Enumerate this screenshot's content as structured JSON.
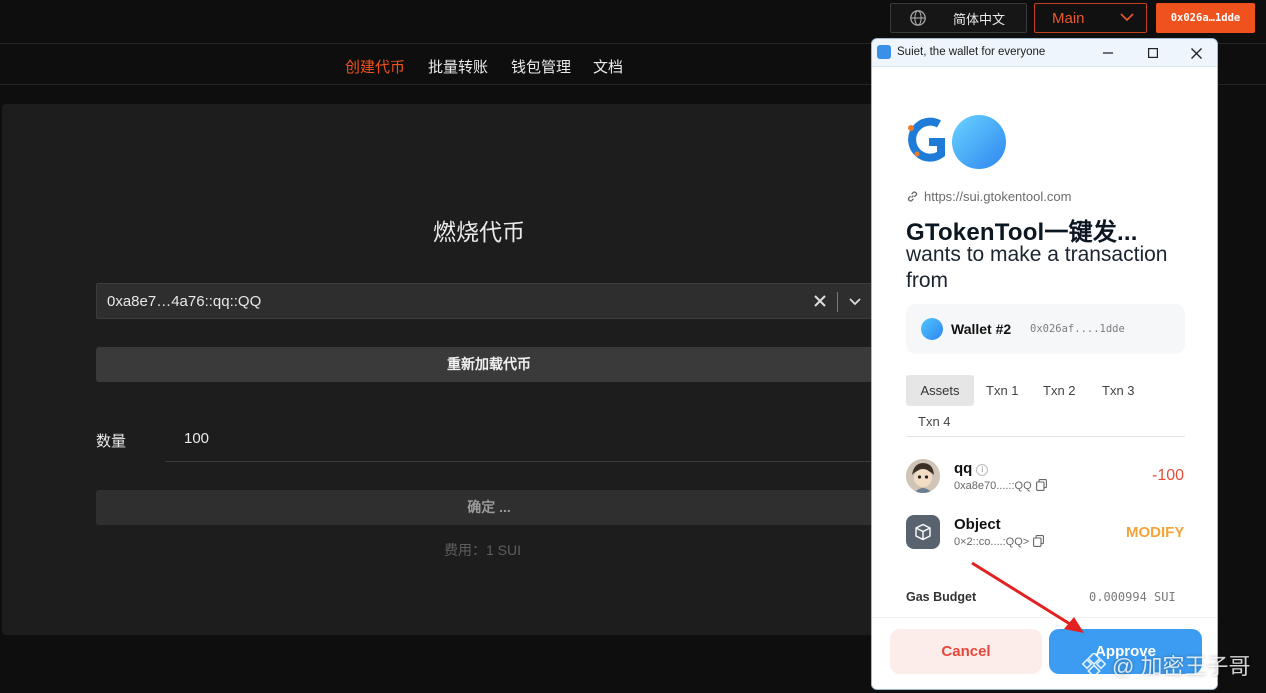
{
  "topbar": {
    "language": "简体中文",
    "network": "Main",
    "account": "0x026a…1dde"
  },
  "nav": {
    "items": [
      {
        "label": "创建代币",
        "active": true
      },
      {
        "label": "批量转账",
        "active": false
      },
      {
        "label": "钱包管理",
        "active": false
      },
      {
        "label": "文档",
        "active": false
      }
    ]
  },
  "burn": {
    "title": "燃烧代币",
    "token_selected": "0xa8e7…4a76::qq::QQ",
    "reload_label": "重新加载代币",
    "quantity_label": "数量",
    "quantity_value": "100",
    "confirm_label": "确定 ...",
    "fee_text": "费用：1 SUI"
  },
  "popup": {
    "window_title": "Suiet, the wallet for everyone",
    "url": "https://sui.gtokentool.com",
    "heading": "GTokenTool一键发...",
    "subheading": "wants to make a transaction from",
    "wallet_name": "Wallet #2",
    "wallet_address": "0x026af....1dde",
    "tabs": [
      "Assets",
      "Txn 1",
      "Txn 2",
      "Txn 3",
      "Txn 4"
    ],
    "active_tab": "Assets",
    "asset": {
      "name": "qq",
      "address": "0xa8e70....::QQ",
      "amount": "-100"
    },
    "object": {
      "name": "Object",
      "address": "0×2::co....:QQ>",
      "action": "MODIFY"
    },
    "gas_label": "Gas Budget",
    "gas_value": "0.000994 SUI",
    "cancel_label": "Cancel",
    "approve_label": "Approve"
  },
  "watermark": "@ 加密王子哥",
  "colors": {
    "accent": "#f0521e",
    "approve": "#3c9cf1",
    "negative": "#e84c3d",
    "modify": "#f5a33a"
  }
}
